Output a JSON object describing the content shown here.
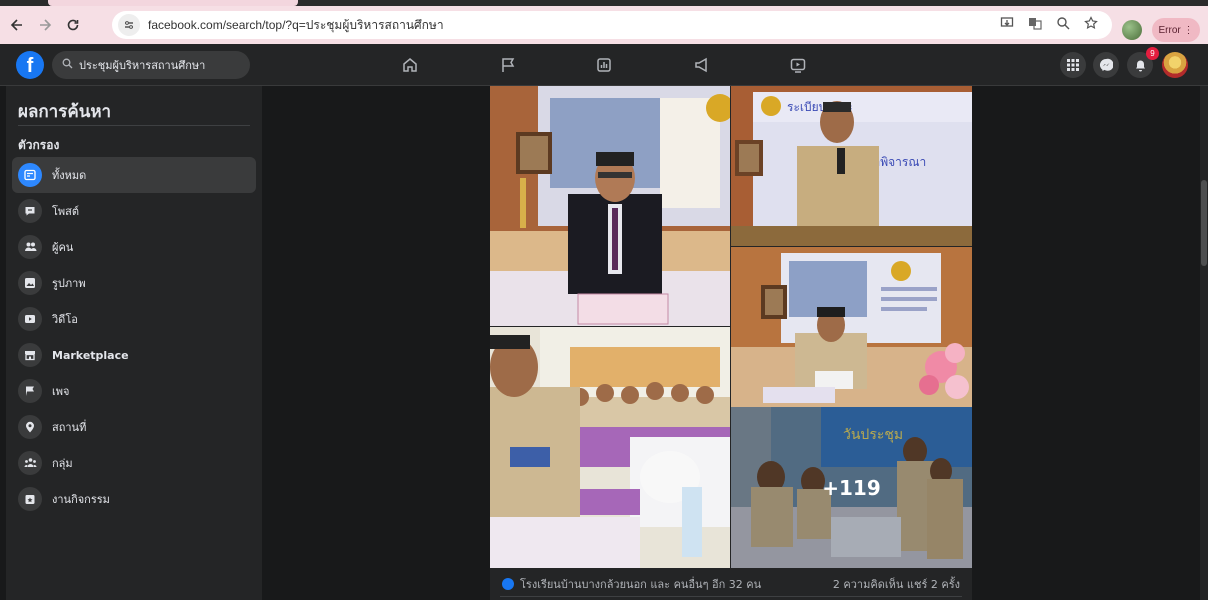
{
  "browser": {
    "url": "facebook.com/search/top/?q=ประชุมผู้บริหารสถานศึกษา",
    "error_label": "Error",
    "menu_glyph": "⋮"
  },
  "fb": {
    "logo_glyph": "f",
    "search_query": "ประชุมผู้บริหารสถานศึกษา",
    "notification_count": "9"
  },
  "sidebar": {
    "title": "ผลการค้นหา",
    "filter_heading": "ตัวกรอง",
    "items": [
      {
        "label": "ทั้งหมด",
        "icon": "feed-icon"
      },
      {
        "label": "โพสต์",
        "icon": "post-icon"
      },
      {
        "label": "ผู้คน",
        "icon": "people-icon"
      },
      {
        "label": "รูปภาพ",
        "icon": "photo-icon"
      },
      {
        "label": "วิดีโอ",
        "icon": "video-icon"
      },
      {
        "label": "Marketplace",
        "icon": "marketplace-icon"
      },
      {
        "label": "เพจ",
        "icon": "flag-icon"
      },
      {
        "label": "สถานที่",
        "icon": "location-icon"
      },
      {
        "label": "กลุ่ม",
        "icon": "group-icon"
      },
      {
        "label": "งานกิจกรรม",
        "icon": "event-icon"
      }
    ]
  },
  "post": {
    "more_photos": "+119",
    "reactions_text": "โรงเรียนบ้านบางกล้วยนอก และ คนอื่นๆ อีก 32 คน",
    "stats_text": "2 ความคิดเห็น  แชร์ 2 ครั้ง",
    "photo_signs": {
      "top_right": "ระเบียบวาระ",
      "top_right_sub": "เพื่อพิจารณา",
      "bottom_right": "วันประชุม"
    }
  },
  "colors": {
    "fb_blue": "#1877f2",
    "bg_dark": "#18191a",
    "surface": "#242526"
  }
}
